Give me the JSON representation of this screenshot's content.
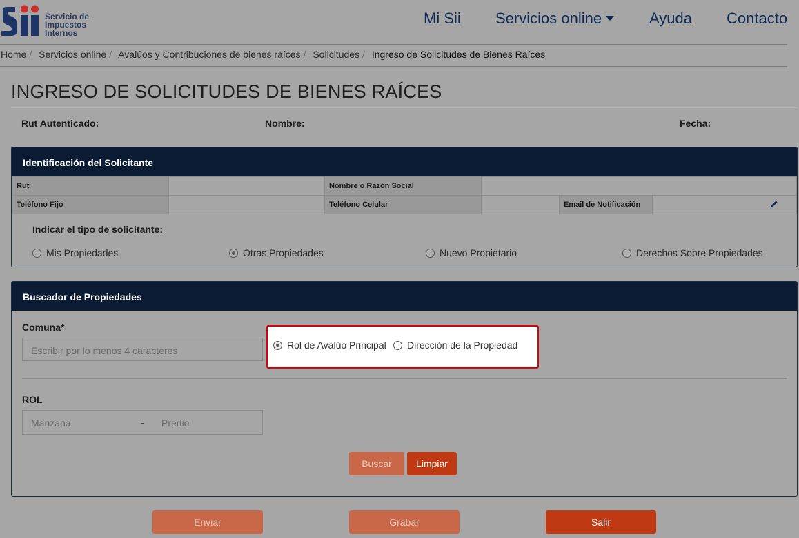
{
  "header": {
    "logo_text_line1": "Servicio de",
    "logo_text_line2": "Impuestos",
    "logo_text_line3": "Internos",
    "nav": {
      "mi_sii": "Mi Sii",
      "servicios": "Servicios online",
      "ayuda": "Ayuda",
      "contacto": "Contacto"
    }
  },
  "breadcrumb": {
    "items": [
      "Home",
      "Servicios online",
      "Avalúos y Contribuciones de bienes raíces",
      "Solicitudes"
    ],
    "current": "Ingreso de Solicitudes de Bienes Raíces",
    "separator": "/"
  },
  "page": {
    "title": "INGRESO DE SOLICITUDES DE BIENES RAÍCES",
    "rut_label": "Rut Autenticado:",
    "nombre_label": "Nombre:",
    "fecha_label": "Fecha:"
  },
  "solicitante": {
    "heading": "Identificación del Solicitante",
    "rut_label": "Rut",
    "rut_value": "",
    "nombre_label": "Nombre o Razón Social",
    "nombre_value": "",
    "telefono_fijo_label": "Teléfono Fijo",
    "telefono_fijo_value": "",
    "telefono_celular_label": "Teléfono Celular",
    "telefono_celular_value": "",
    "email_label": "Email de Notificación",
    "email_value": "",
    "tipo_label": "Indicar el tipo de solicitante:",
    "options": [
      "Mis Propiedades",
      "Otras Propiedades",
      "Nuevo Propietario",
      "Derechos Sobre Propiedades"
    ],
    "selected": "Otras Propiedades"
  },
  "buscador": {
    "heading": "Buscador de Propiedades",
    "comuna_label": "Comuna*",
    "comuna_placeholder": "Escribir por lo menos 4 caracteres",
    "search_options": [
      "Rol de Avalúo Principal",
      "Dirección de la Propiedad"
    ],
    "search_selected": "Rol de Avalúo Principal",
    "rol_label": "ROL",
    "manzana_placeholder": "Manzana",
    "rol_separator": "-",
    "predio_placeholder": "Predio",
    "buscar_label": "Buscar",
    "limpiar_label": "Limpiar"
  },
  "footer_buttons": {
    "enviar": "Enviar",
    "grabar": "Grabar",
    "salir": "Salir"
  },
  "colors": {
    "navy": "#0a1b33",
    "brand_blue": "#0f2a55",
    "accent_orange": "#bf3a12",
    "highlight_red": "#e00000"
  }
}
